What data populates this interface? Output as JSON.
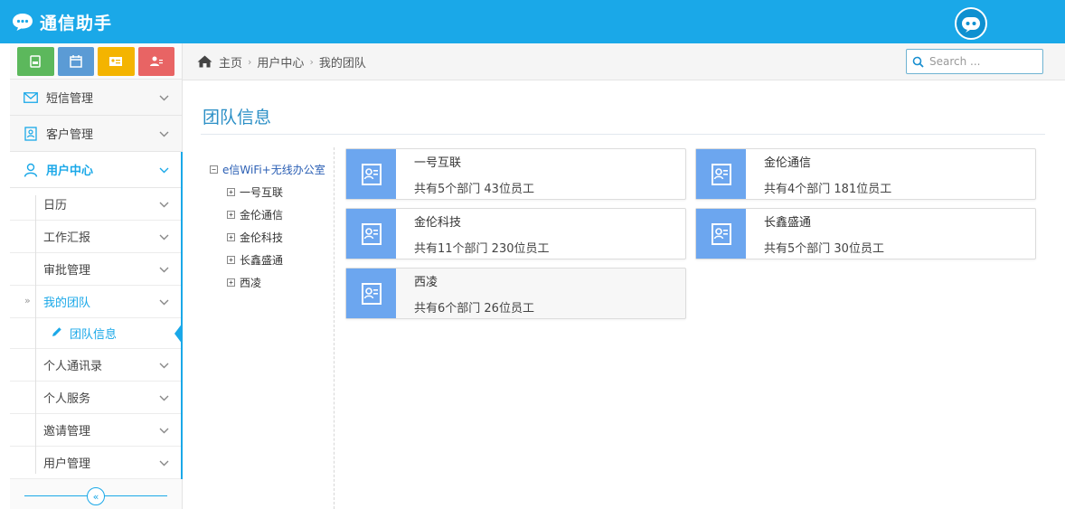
{
  "app": {
    "title": "通信助手"
  },
  "colors": {
    "primary": "#1aa8e8",
    "card_icon": "#6ca6ef",
    "title": "#2b8fc6"
  },
  "shortcuts": [
    {
      "name": "shortcut-message-icon",
      "color": "#5cb85c"
    },
    {
      "name": "shortcut-calendar-icon",
      "color": "#5b9bd5"
    },
    {
      "name": "shortcut-contact-card-icon",
      "color": "#f4b400"
    },
    {
      "name": "shortcut-user-settings-icon",
      "color": "#e86464"
    }
  ],
  "sidebar": {
    "items": [
      {
        "label": "短信管理",
        "icon": "envelope-icon"
      },
      {
        "label": "客户管理",
        "icon": "address-book-icon"
      },
      {
        "label": "用户中心",
        "icon": "user-icon"
      }
    ],
    "sub_items": [
      {
        "label": "日历"
      },
      {
        "label": "工作汇报"
      },
      {
        "label": "审批管理"
      },
      {
        "label": "我的团队"
      },
      {
        "label": "团队信息"
      },
      {
        "label": "个人通讯录"
      },
      {
        "label": "个人服务"
      },
      {
        "label": "邀请管理"
      },
      {
        "label": "用户管理"
      }
    ]
  },
  "breadcrumb": [
    "主页",
    "用户中心",
    "我的团队"
  ],
  "search": {
    "placeholder": "Search ..."
  },
  "main": {
    "title": "团队信息",
    "tree": {
      "root": "e信WiFi+无线办公室",
      "children": [
        "一号互联",
        "金伦通信",
        "金伦科技",
        "长鑫盛通",
        "西凌"
      ]
    },
    "cards": [
      {
        "name": "一号互联",
        "stat": "共有5个部门 43位员工"
      },
      {
        "name": "金伦通信",
        "stat": "共有4个部门 181位员工"
      },
      {
        "name": "金伦科技",
        "stat": "共有11个部门 230位员工"
      },
      {
        "name": "长鑫盛通",
        "stat": "共有5个部门 30位员工"
      },
      {
        "name": "西凌",
        "stat": "共有6个部门 26位员工"
      }
    ]
  }
}
